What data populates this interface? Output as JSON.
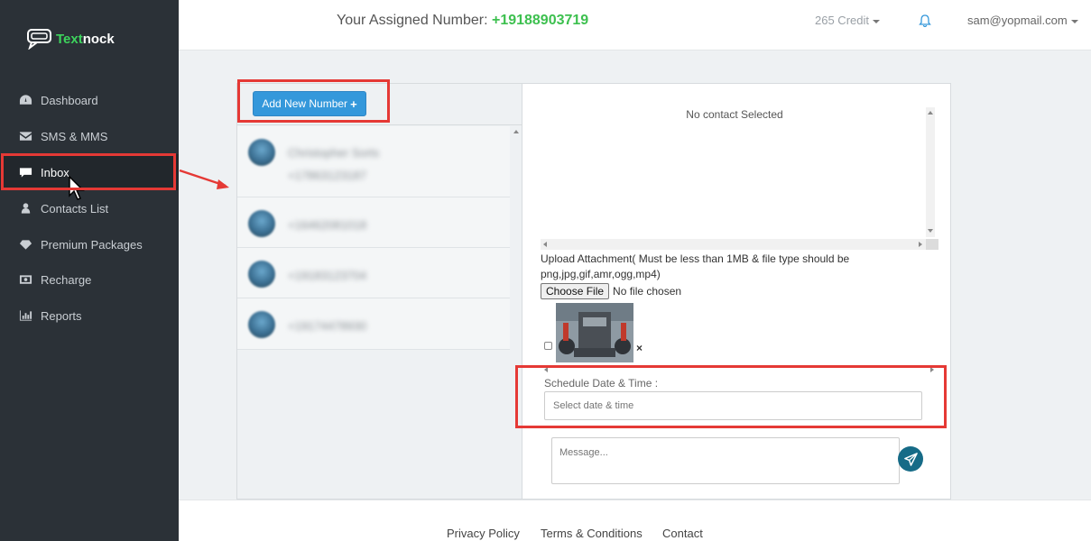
{
  "brand": {
    "part1": "Text",
    "part2": "nock"
  },
  "sidebar": {
    "items": [
      {
        "label": "Dashboard",
        "icon": "dashboard-icon"
      },
      {
        "label": "SMS & MMS",
        "icon": "envelope-icon"
      },
      {
        "label": "Inbox",
        "icon": "chat-icon",
        "active": true
      },
      {
        "label": "Contacts List",
        "icon": "user-icon"
      },
      {
        "label": "Premium Packages",
        "icon": "diamond-icon"
      },
      {
        "label": "Recharge",
        "icon": "money-icon"
      },
      {
        "label": "Reports",
        "icon": "bar-chart-icon"
      }
    ]
  },
  "header": {
    "assigned_label": "Your Assigned Number:",
    "assigned_number": "+19188903719",
    "credit": "265 Credit",
    "user_email": "sam@yopmail.com"
  },
  "left_panel": {
    "add_button": "Add New Number",
    "add_icon": "+",
    "contacts": [
      {
        "name": "Christopher Sorts",
        "number": "+17863123187"
      },
      {
        "name": "+16462081018",
        "number": ""
      },
      {
        "name": "+19183123704",
        "number": ""
      },
      {
        "name": "+19174478930",
        "number": ""
      }
    ]
  },
  "right_panel": {
    "no_contact": "No contact Selected",
    "upload_label": "Upload Attachment( Must be less than 1MB & file type should be png,jpg,gif,amr,ogg,mp4)",
    "choose_file": "Choose File",
    "no_file": "No file chosen",
    "remove_icon": "×",
    "schedule_label": "Schedule Date & Time :",
    "schedule_placeholder": "Select date & time",
    "message_placeholder": "Message..."
  },
  "footer": {
    "links": [
      "Privacy Policy",
      "Terms & Conditions",
      "Contact"
    ]
  },
  "colors": {
    "sidebar_bg": "#2b3137",
    "accent_green": "#3dc04f",
    "button_blue": "#3498db",
    "send_teal": "#166b87",
    "annotation_red": "#e53935"
  }
}
